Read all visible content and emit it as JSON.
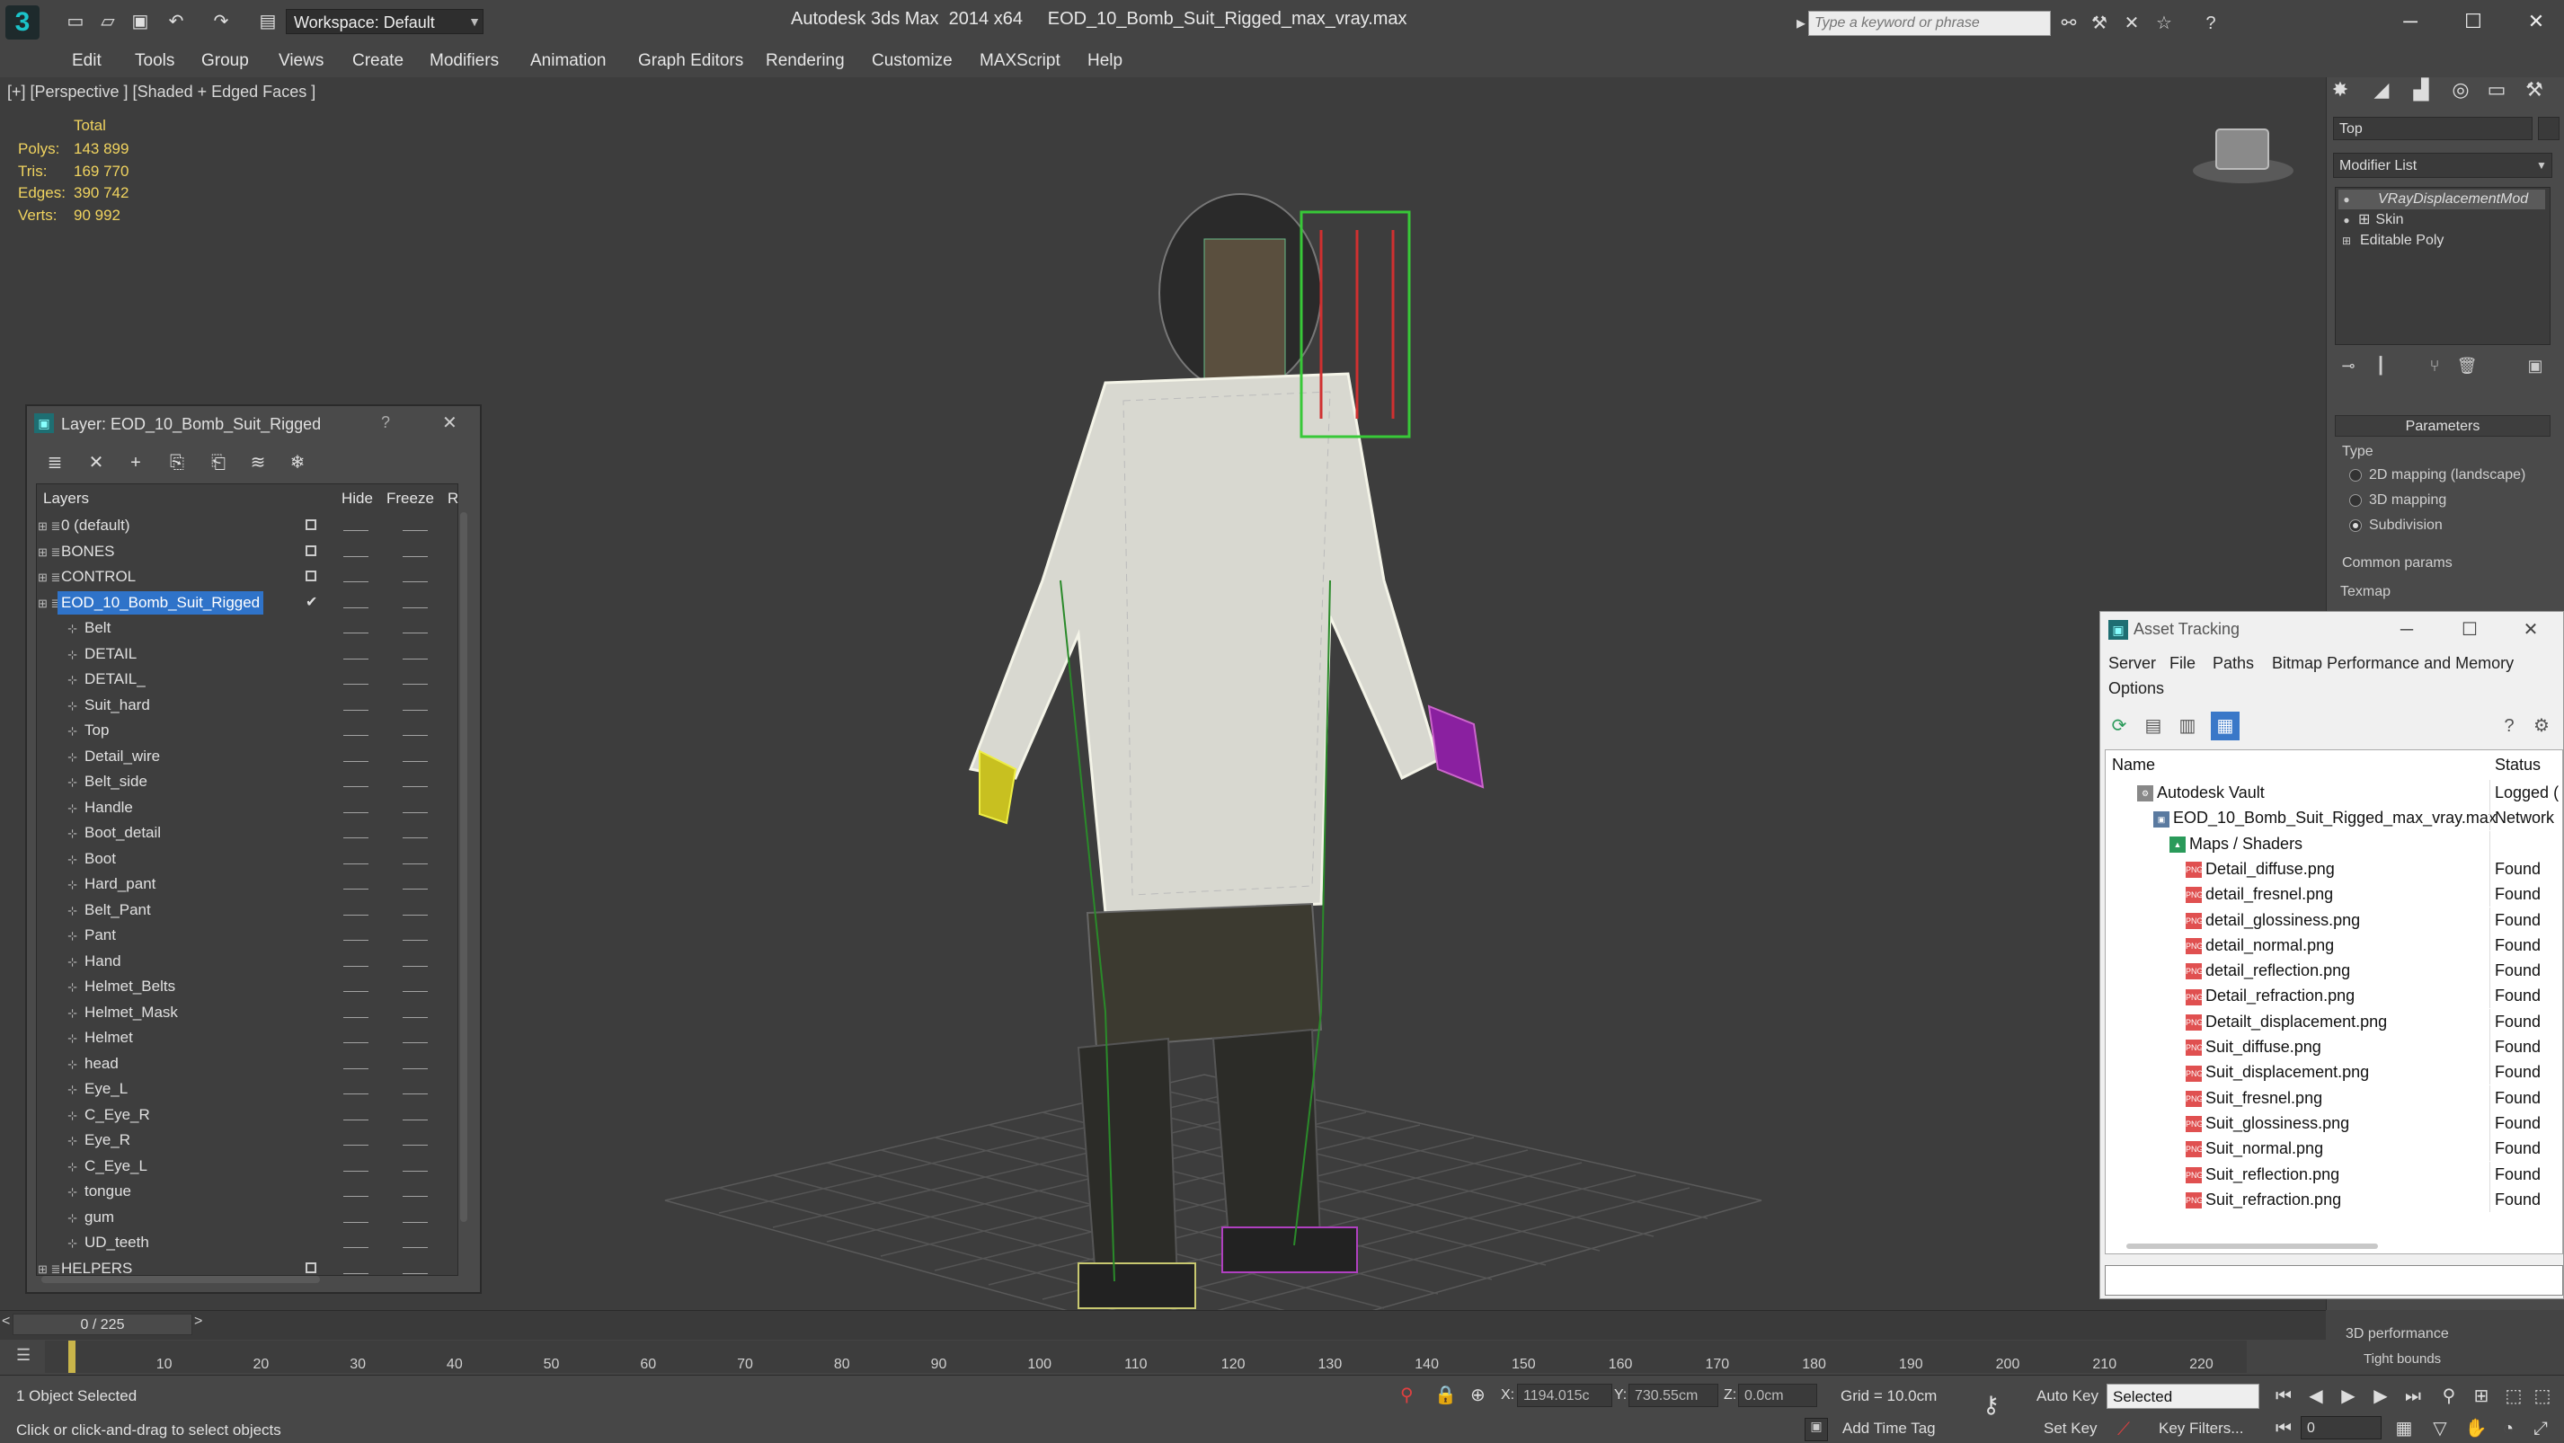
{
  "titlebar": {
    "app_title": "Autodesk 3ds Max  2014 x64     EOD_10_Bomb_Suit_Rigged_max_vray.max",
    "workspace": "Workspace: Default",
    "search_placeholder": "Type a keyword or phrase",
    "quick_access_icons": [
      "new-icon",
      "open-icon",
      "save-icon",
      "undo-icon",
      "redo-icon",
      "project-icon"
    ]
  },
  "menu": [
    "Edit",
    "Tools",
    "Group",
    "Views",
    "Create",
    "Modifiers",
    "Animation",
    "Graph Editors",
    "Rendering",
    "Customize",
    "MAXScript",
    "Help"
  ],
  "viewport": {
    "label": "[+] [Perspective ] [Shaded + Edged Faces ]",
    "stats_total_label": "Total",
    "stats": [
      {
        "k": "Polys:",
        "v": "143 899"
      },
      {
        "k": "Tris:",
        "v": "169 770"
      },
      {
        "k": "Edges:",
        "v": "390 742"
      },
      {
        "k": "Verts:",
        "v": "90 992"
      }
    ]
  },
  "command_panel": {
    "object_name": "Top",
    "modifier_list": "Modifier List",
    "stack": [
      "VRayDisplacementMod",
      "Skin",
      "Editable Poly"
    ],
    "parameters_title": "Parameters",
    "type_label": "Type",
    "type_options": [
      "2D mapping (landscape)",
      "3D mapping",
      "Subdivision"
    ],
    "type_selected": "Subdivision",
    "common_params": "Common params",
    "texmap": "Texmap",
    "perf_label": "3D performance",
    "tight_bounds": "Tight bounds"
  },
  "layer_dialog": {
    "title": "Layer: EOD_10_Bomb_Suit_Rigged",
    "col_layers": "Layers",
    "col_hide": "Hide",
    "col_freeze": "Freeze",
    "col_r": "R",
    "layers": [
      {
        "name": "0 (default)",
        "level": 0
      },
      {
        "name": "BONES",
        "level": 0
      },
      {
        "name": "CONTROL",
        "level": 0
      },
      {
        "name": "EOD_10_Bomb_Suit_Rigged",
        "level": 0,
        "selected": true
      },
      {
        "name": "Belt",
        "level": 1
      },
      {
        "name": "DETAIL",
        "level": 1
      },
      {
        "name": "DETAIL_",
        "level": 1
      },
      {
        "name": "Suit_hard",
        "level": 1
      },
      {
        "name": "Top",
        "level": 1
      },
      {
        "name": "Detail_wire",
        "level": 1
      },
      {
        "name": "Belt_side",
        "level": 1
      },
      {
        "name": "Handle",
        "level": 1
      },
      {
        "name": "Boot_detail",
        "level": 1
      },
      {
        "name": "Boot",
        "level": 1
      },
      {
        "name": "Hard_pant",
        "level": 1
      },
      {
        "name": "Belt_Pant",
        "level": 1
      },
      {
        "name": "Pant",
        "level": 1
      },
      {
        "name": "Hand",
        "level": 1
      },
      {
        "name": "Helmet_Belts",
        "level": 1
      },
      {
        "name": "Helmet_Mask",
        "level": 1
      },
      {
        "name": "Helmet",
        "level": 1
      },
      {
        "name": "head",
        "level": 1
      },
      {
        "name": "Eye_L",
        "level": 1
      },
      {
        "name": "C_Eye_R",
        "level": 1
      },
      {
        "name": "Eye_R",
        "level": 1
      },
      {
        "name": "C_Eye_L",
        "level": 1
      },
      {
        "name": "tongue",
        "level": 1
      },
      {
        "name": "gum",
        "level": 1
      },
      {
        "name": "UD_teeth",
        "level": 1
      },
      {
        "name": "HELPERS",
        "level": 0
      }
    ]
  },
  "asset_tracking": {
    "title": "Asset Tracking",
    "menu": [
      "Server",
      "File",
      "Paths",
      "Bitmap Performance and Memory"
    ],
    "options": "Options",
    "col_name": "Name",
    "col_status": "Status",
    "rows": [
      {
        "name": "Autodesk Vault",
        "status": "Logged (",
        "level": 0
      },
      {
        "name": "EOD_10_Bomb_Suit_Rigged_max_vray.max",
        "status": "Network",
        "level": 1
      },
      {
        "name": "Maps / Shaders",
        "status": "",
        "level": 2
      },
      {
        "name": "Detail_diffuse.png",
        "status": "Found",
        "level": 3
      },
      {
        "name": "detail_fresnel.png",
        "status": "Found",
        "level": 3
      },
      {
        "name": "detail_glossiness.png",
        "status": "Found",
        "level": 3
      },
      {
        "name": "detail_normal.png",
        "status": "Found",
        "level": 3
      },
      {
        "name": "detail_reflection.png",
        "status": "Found",
        "level": 3
      },
      {
        "name": "Detail_refraction.png",
        "status": "Found",
        "level": 3
      },
      {
        "name": "Detailt_displacement.png",
        "status": "Found",
        "level": 3
      },
      {
        "name": "Suit_diffuse.png",
        "status": "Found",
        "level": 3
      },
      {
        "name": "Suit_displacement.png",
        "status": "Found",
        "level": 3
      },
      {
        "name": "Suit_fresnel.png",
        "status": "Found",
        "level": 3
      },
      {
        "name": "Suit_glossiness.png",
        "status": "Found",
        "level": 3
      },
      {
        "name": "Suit_normal.png",
        "status": "Found",
        "level": 3
      },
      {
        "name": "Suit_reflection.png",
        "status": "Found",
        "level": 3
      },
      {
        "name": "Suit_refraction.png",
        "status": "Found",
        "level": 3
      }
    ]
  },
  "timeline": {
    "counter": "0 / 225",
    "ticks": [
      "10",
      "20",
      "30",
      "40",
      "50",
      "60",
      "70",
      "80",
      "90",
      "100",
      "110",
      "120",
      "130",
      "140",
      "150",
      "160",
      "170",
      "180",
      "190",
      "200",
      "210",
      "220"
    ]
  },
  "statusbar": {
    "selection": "1 Object Selected",
    "prompt": "Click or click-and-drag to select objects",
    "x_label": "X:",
    "x_value": "1194.015c",
    "y_label": "Y:",
    "y_value": "730.55cm",
    "z_label": "Z:",
    "z_value": "0.0cm",
    "grid": "Grid = 10.0cm",
    "add_time_tag": "Add Time Tag",
    "auto_key": "Auto Key",
    "set_key": "Set Key",
    "selected": "Selected",
    "key_filters": "Key Filters...",
    "frame": "0"
  }
}
